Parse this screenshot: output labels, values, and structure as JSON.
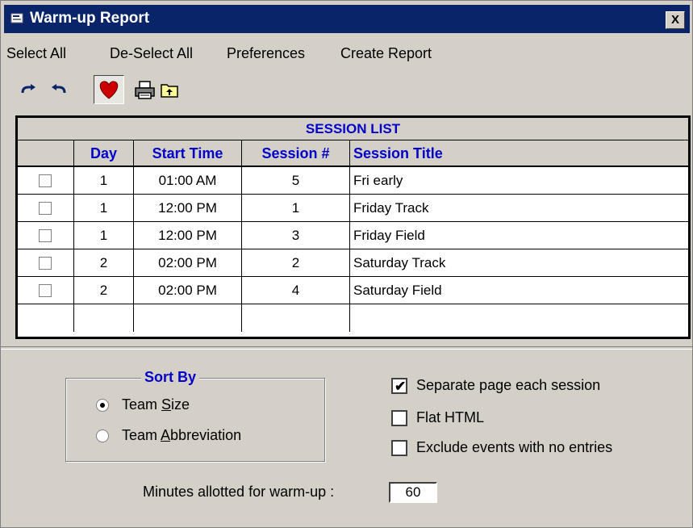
{
  "window": {
    "title": "Warm-up Report",
    "close_label": "X"
  },
  "menu": {
    "select_all": "Select All",
    "deselect_all": "De-Select All",
    "preferences": "Preferences",
    "create_report": "Create Report"
  },
  "toolbar": {
    "icons": [
      "redo-icon",
      "undo-icon",
      "heart-icon",
      "print-icon",
      "folder-up-icon"
    ],
    "heart_color": "#cc0000"
  },
  "session_list": {
    "title": "SESSION LIST",
    "columns": [
      "Day",
      "Start Time",
      "Session #",
      "Session Title"
    ],
    "rows": [
      {
        "checked": false,
        "day": "1",
        "start_time": "01:00 AM",
        "session": "5",
        "title": "Fri early"
      },
      {
        "checked": false,
        "day": "1",
        "start_time": "12:00 PM",
        "session": "1",
        "title": "Friday Track"
      },
      {
        "checked": false,
        "day": "1",
        "start_time": "12:00 PM",
        "session": "3",
        "title": "Friday Field"
      },
      {
        "checked": false,
        "day": "2",
        "start_time": "02:00 PM",
        "session": "2",
        "title": "Saturday Track"
      },
      {
        "checked": false,
        "day": "2",
        "start_time": "02:00 PM",
        "session": "4",
        "title": "Saturday Field"
      }
    ]
  },
  "sort_by": {
    "title": "Sort By",
    "options": [
      {
        "label": "Team Size",
        "accel": "S",
        "selected": true
      },
      {
        "label": "Team Abbreviation",
        "accel": "A",
        "selected": false
      }
    ]
  },
  "options": {
    "separate_page": {
      "label": "Separate page each session",
      "checked": true
    },
    "flat_html": {
      "label": "Flat HTML",
      "checked": false
    },
    "exclude_empty": {
      "label": "Exclude events with no entries",
      "checked": false
    }
  },
  "minutes": {
    "label": "Minutes allotted for warm-up :",
    "value": "60"
  },
  "colors": {
    "titlebar": "#0a246a",
    "header_text": "#0000c8",
    "face": "#d4d0c8"
  }
}
